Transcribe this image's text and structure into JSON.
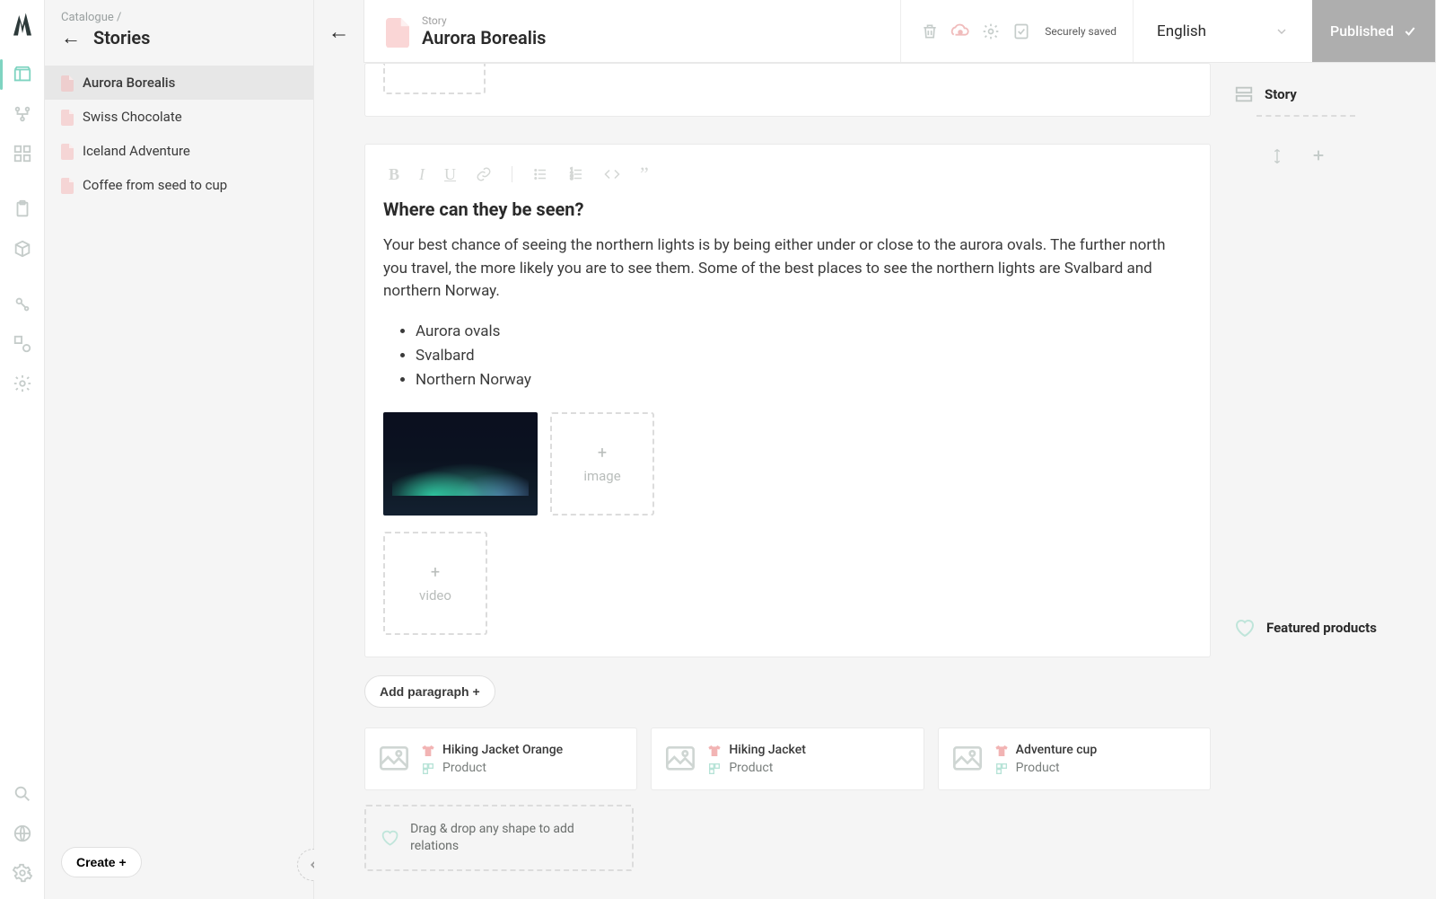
{
  "sidebar": {
    "breadcrumb": "Catalogue  /",
    "title": "Stories",
    "items": [
      {
        "label": "Aurora Borealis"
      },
      {
        "label": "Swiss Chocolate"
      },
      {
        "label": "Iceland Adventure"
      },
      {
        "label": "Coffee from seed to cup"
      }
    ],
    "create": "Create +"
  },
  "header": {
    "kicker": "Story",
    "title": "Aurora Borealis",
    "saved": "Securely saved",
    "language": "English",
    "publish": "Published"
  },
  "storyLabel": "Story",
  "featuredLabel": "Featured products",
  "article": {
    "heading": "Where can they be seen?",
    "paragraph": "Your best chance of seeing the northern lights is by being either under or close to the aurora ovals. The further north you travel, the more likely you are to see them. Some of the best places to see the northern lights are Svalbard and northern Norway.",
    "bullets": [
      "Aurora ovals",
      "Svalbard",
      "Northern Norway"
    ],
    "imagePlaceholder": "image",
    "videoPlaceholder": "video"
  },
  "addParagraph": "Add paragraph +",
  "products": [
    {
      "name": "Hiking Jacket Orange",
      "type": "Product"
    },
    {
      "name": "Hiking Jacket",
      "type": "Product"
    },
    {
      "name": "Adventure cup",
      "type": "Product"
    }
  ],
  "relationsHint": "Drag & drop any shape to add relations"
}
